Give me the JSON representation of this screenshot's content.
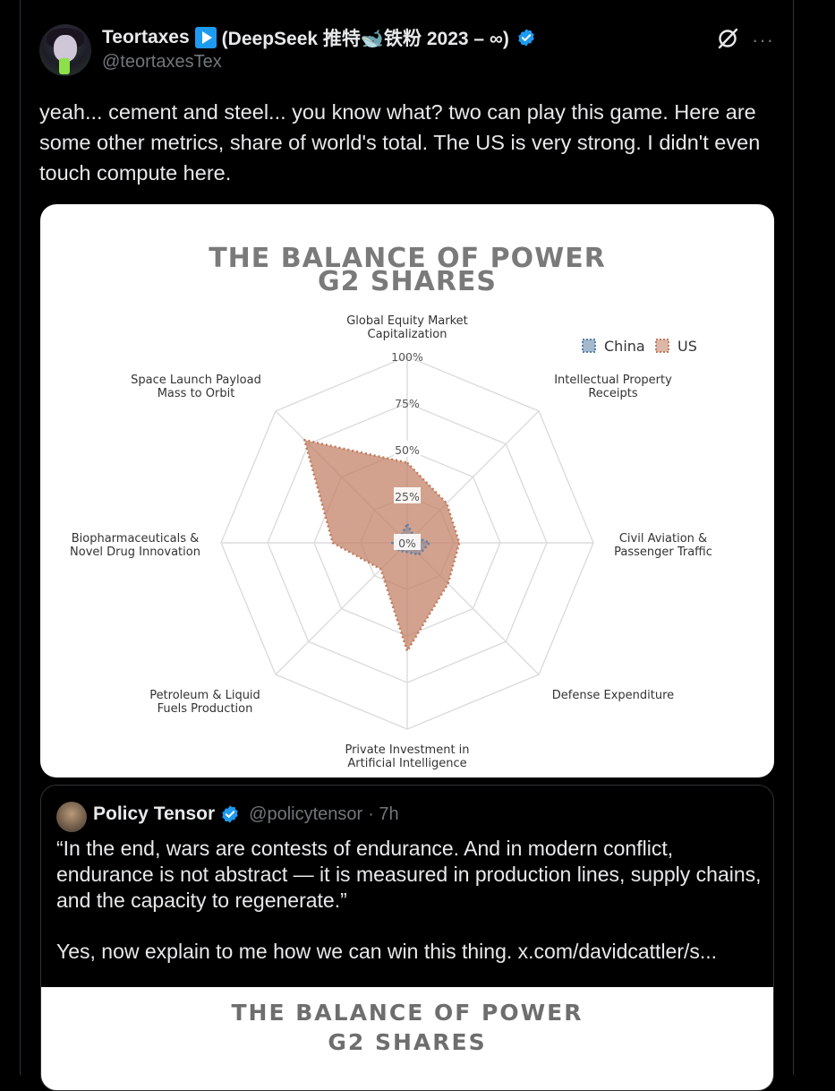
{
  "tweet": {
    "display_name": "Teortaxes",
    "display_name_suffix": "(DeepSeek 推特🐋铁粉 2023 – ∞)",
    "handle": "@teortaxesTex",
    "text": "yeah... cement and steel... you know what? two can play this game. Here are some other metrics, share of world's total. The US is very strong. I didn't even touch compute here.",
    "icons": [
      "play-badge-icon",
      "verified-icon",
      "grok-icon",
      "more-icon"
    ],
    "more_label": "···"
  },
  "chart_data": {
    "type": "radar",
    "title_line1": "THE BALANCE OF POWER",
    "title_line2": "G2 SHARES",
    "categories": [
      "Global Equity Market Capitalization",
      "Intellectual Property Receipts",
      "Civil Aviation & Passenger Traffic",
      "Defense Expenditure",
      "Private Investment in Artificial Intelligence",
      "Petroleum & Liquid Fuels Production",
      "Biopharmaceuticals & Novel Drug Innovation",
      "Space Launch Payload Mass to Orbit"
    ],
    "category_labels": [
      [
        "Global Equity Market",
        "Capitalization"
      ],
      [
        "Intellectual Property",
        "Receipts"
      ],
      [
        "Civil Aviation &",
        "Passenger Traffic"
      ],
      [
        "Defense Expenditure"
      ],
      [
        "Private Investment in",
        "Artificial Intelligence"
      ],
      [
        "Petroleum & Liquid",
        "Fuels Production"
      ],
      [
        "Biopharmaceuticals &",
        "Novel Drug Innovation"
      ],
      [
        "Space Launch Payload",
        "Mass to Orbit"
      ]
    ],
    "series": [
      {
        "name": "China",
        "values": [
          10,
          5,
          12,
          9,
          5,
          6,
          8,
          5
        ],
        "color": "#5b7fa6"
      },
      {
        "name": "US",
        "values": [
          43,
          30,
          28,
          31,
          58,
          20,
          40,
          78
        ],
        "color": "#c07b5e"
      }
    ],
    "radial_ticks": [
      "0%",
      "25%",
      "50%",
      "75%",
      "100%"
    ],
    "rlim": [
      0,
      100
    ],
    "legend_placement": "top-right",
    "grid": true
  },
  "quote": {
    "display_name": "Policy Tensor",
    "handle": "@policytensor",
    "time": "· 7h",
    "text_1": "“In the end, wars are contests of endurance. And in modern conflict, endurance is not abstract — it is measured in production lines, supply chains, and the capacity to regenerate.”",
    "text_2": "Yes, now explain to me how we can win this thing.  x.com/davidcattler/s...",
    "image_title_line1": "THE BALANCE OF POWER",
    "image_title_line2": "G2 SHARES"
  }
}
